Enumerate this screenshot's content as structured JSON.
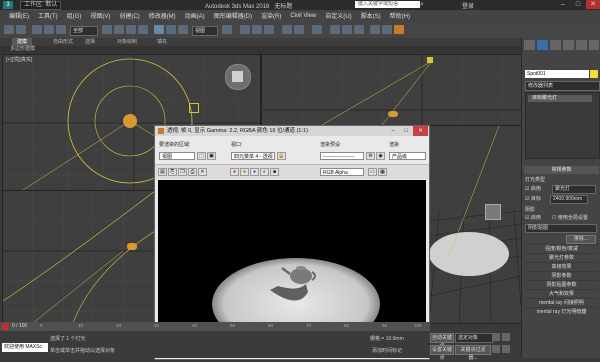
{
  "titlebar": {
    "app_title": "Autodesk 3ds Max 2016",
    "doc_title": "无标题",
    "workspace": "工作区: 默认",
    "search_placeholder": "键入关键字或短语",
    "user": "登录"
  },
  "menu": [
    "编辑(E)",
    "工具(T)",
    "组(G)",
    "视图(V)",
    "创建(C)",
    "修改器(M)",
    "动画(A)",
    "图形编辑器(D)",
    "渲染(R)",
    "Civil View",
    "自定义(U)",
    "脚本(S)",
    "帮助(H)"
  ],
  "toolbar": {
    "filter": "全部",
    "view_select": "视图"
  },
  "ribbon": {
    "tabs": [
      "建模",
      "自由形式",
      "选择",
      "对象绘制",
      "填充"
    ],
    "sub_label": "多边形建模"
  },
  "viewports": {
    "top_left_label": "[+][顶][真实]",
    "left_label": "[+][左][线框]"
  },
  "dialog": {
    "title": "透视, 帧 0, 显示 Gamma: 2.2, RGBA 颜色 16 位/通道 (1:1)",
    "area_label": "要渲染的区域:",
    "area_value": "视图",
    "viewport_label": "视口:",
    "viewport_value": "四元菜单 4 - 透视",
    "preset_label": "渲染预设:",
    "preset_value": "-------------------",
    "renderer_label": "渲染",
    "renderer_value": "产品级",
    "channel_value": "RGB Alpha"
  },
  "command_panel": {
    "object_name": "Spot001",
    "modifier_list": "修改器列表",
    "stack_item": "目标聚光灯",
    "rollout_general": "常规参数",
    "light_type_label": "灯光类型",
    "enabled_label": "启用",
    "light_type_value": "聚光灯",
    "target_label": "目标",
    "target_value": "2400.906mm",
    "shadow_label": "阴影",
    "shadow_enabled": "启用",
    "global_label": "使用全局设置",
    "shadow_type": "阴影贴图",
    "exclude_btn": "排除...",
    "rollouts": [
      "强度/颜色/衰减",
      "聚光灯参数",
      "高级效果",
      "阴影参数",
      "阴影贴图参数",
      "大气和效果",
      "mental ray 间接照明",
      "mental ray 灯光明暗器"
    ]
  },
  "timeline": {
    "frame": "0 / 100",
    "ticks": [
      "0",
      "10",
      "20",
      "30",
      "40",
      "50",
      "60",
      "70",
      "80",
      "90",
      "100"
    ]
  },
  "status": {
    "selected": "选择了 1 个灯光",
    "hint": "单击或单击并拖动以选择对象",
    "maxscript": "欢迎使用 MAXSc",
    "grid": "栅格 = 10.0mm",
    "autokey": "自动关键点",
    "selected_obj": "选定对象",
    "add_time_tag": "添加时间标记",
    "set_key": "设置关键点",
    "key_filter": "关键点过滤器..."
  },
  "colors": {
    "accent": "#3a6ea8",
    "render_bg": "#000000",
    "viewport_bg": "#3f3f3f"
  }
}
